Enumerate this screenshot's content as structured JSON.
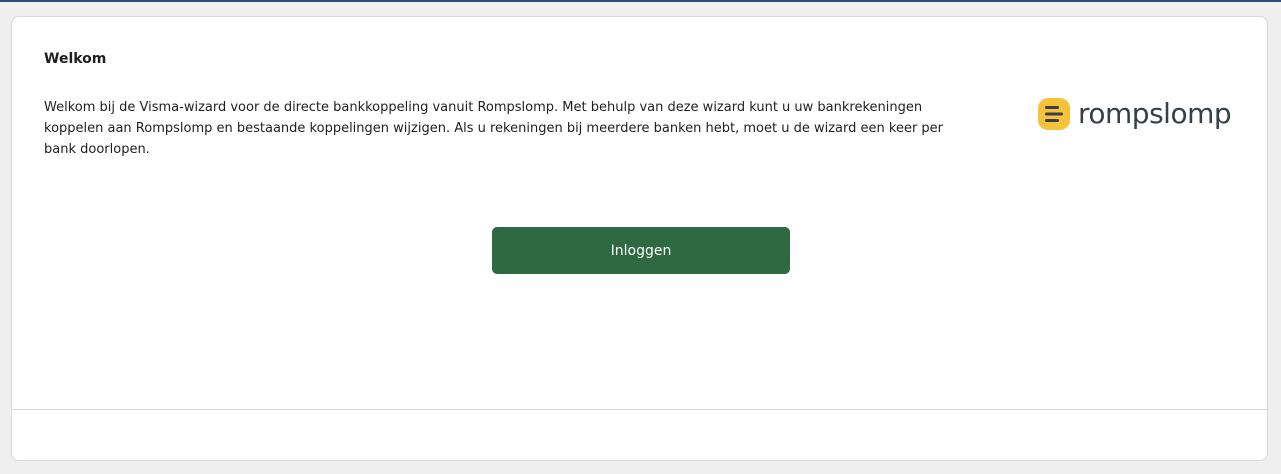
{
  "wizard": {
    "title": "Welkom",
    "intro_text": "Welkom bij de Visma-wizard voor de directe bankkoppeling vanuit Rompslomp. Met behulp van deze wizard kunt u uw bankrekeningen koppelen aan Rompslomp en bestaande koppelingen wijzigen. Als u rekeningen bij meerdere banken hebt, moet u de wizard een keer per bank doorlopen.",
    "login_button_label": "Inloggen"
  },
  "logo": {
    "text": "rompslomp",
    "icon": "rompslomp-stack-icon"
  },
  "colors": {
    "primary_button": "#2e6940",
    "logo_badge": "#f7c23b",
    "logo_text": "#36404a",
    "page_background": "#efeff0",
    "top_accent": "#2f4f7a"
  }
}
